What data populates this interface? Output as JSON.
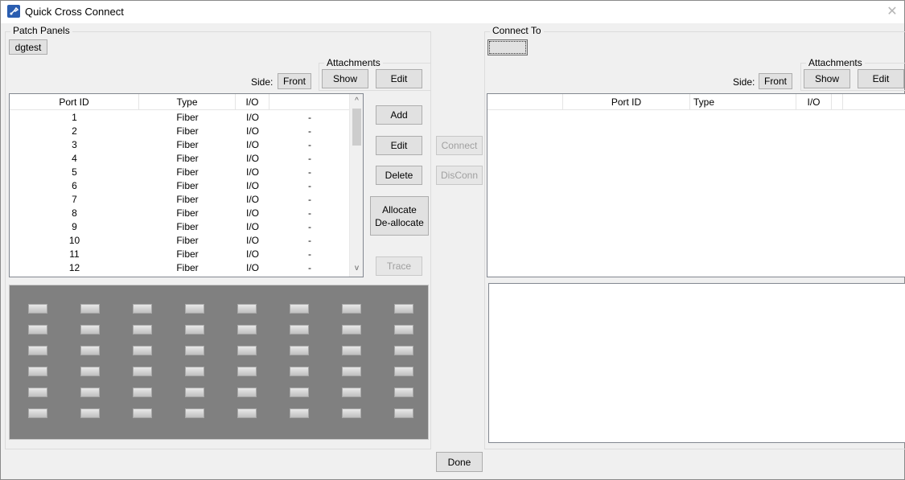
{
  "window": {
    "title": "Quick Cross Connect",
    "close_glyph": "✕"
  },
  "left": {
    "group_label": "Patch Panels",
    "panel_name": "dgtest",
    "side_label": "Side:",
    "side_value": "Front",
    "attachments_label": "Attachments",
    "show_label": "Show",
    "edit_label": "Edit",
    "columns": [
      "Port ID",
      "Type",
      "I/O",
      ""
    ],
    "rows": [
      [
        "1",
        "Fiber",
        "I/O",
        "-"
      ],
      [
        "2",
        "Fiber",
        "I/O",
        "-"
      ],
      [
        "3",
        "Fiber",
        "I/O",
        "-"
      ],
      [
        "4",
        "Fiber",
        "I/O",
        "-"
      ],
      [
        "5",
        "Fiber",
        "I/O",
        "-"
      ],
      [
        "6",
        "Fiber",
        "I/O",
        "-"
      ],
      [
        "7",
        "Fiber",
        "I/O",
        "-"
      ],
      [
        "8",
        "Fiber",
        "I/O",
        "-"
      ],
      [
        "9",
        "Fiber",
        "I/O",
        "-"
      ],
      [
        "10",
        "Fiber",
        "I/O",
        "-"
      ],
      [
        "11",
        "Fiber",
        "I/O",
        "-"
      ],
      [
        "12",
        "Fiber",
        "I/O",
        "-"
      ]
    ],
    "actions": {
      "add": "Add",
      "edit": "Edit",
      "delete": "Delete",
      "allocate": "Allocate",
      "deallocate": "De-allocate",
      "trace": "Trace"
    },
    "panel_ports": {
      "rows": 6,
      "cols": 8
    }
  },
  "middle": {
    "connect": "Connect",
    "disconnect": "DisConn",
    "done": "Done"
  },
  "right": {
    "group_label": "Connect To",
    "selector_value": "",
    "side_label": "Side:",
    "side_value": "Front",
    "attachments_label": "Attachments",
    "show_label": "Show",
    "edit_label": "Edit",
    "columns": [
      "",
      "Port ID",
      "Type",
      "I/O",
      ""
    ]
  },
  "icons": {
    "scroll_up": "^",
    "scroll_down": "v"
  }
}
